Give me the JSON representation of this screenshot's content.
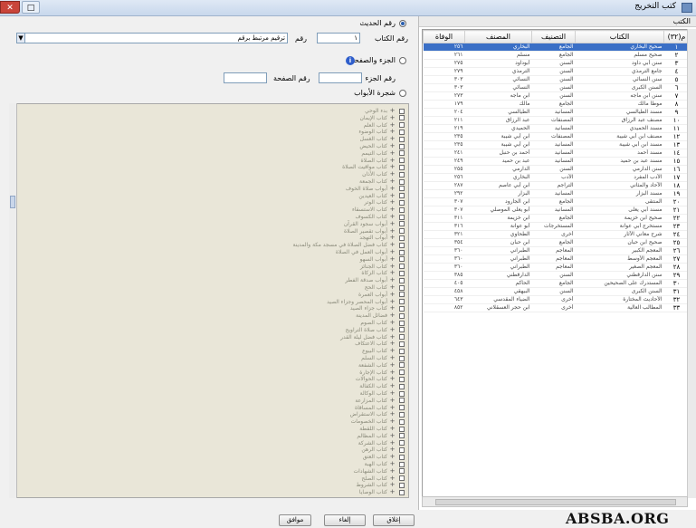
{
  "window": {
    "title": "كتب التخريج",
    "close": "✕",
    "maximize": "□"
  },
  "right_panel": {
    "header": "الكتب",
    "columns": [
      "م(٣٢)",
      "الكتاب",
      "التصنيف",
      "المصنف",
      "الوفاة"
    ],
    "rows": [
      [
        "١",
        "صحيح البخاري",
        "الجامع",
        "البخاري",
        "٢٥٦"
      ],
      [
        "٢",
        "صحيح مسلم",
        "الجامع",
        "مسلم",
        "٢٦١"
      ],
      [
        "٣",
        "سنن أبي داود",
        "السنن",
        "أبوداود",
        "٢٧٥"
      ],
      [
        "٤",
        "جامع الترمذي",
        "السنن",
        "الترمذي",
        "٢٧٩"
      ],
      [
        "٥",
        "سنن النسائي",
        "السنن",
        "النسائي",
        "٣٠٣"
      ],
      [
        "٦",
        "السنن الكبرى",
        "السنن",
        "النسائي",
        "٣٠٣"
      ],
      [
        "٧",
        "سنن ابن ماجه",
        "السنن",
        "ابن ماجه",
        "٢٧٣"
      ],
      [
        "٨",
        "موطأ مالك",
        "الجامع",
        "مالك",
        "١٧٩"
      ],
      [
        "٩",
        "مسند الطيالسي",
        "المسانيد",
        "الطيالسي",
        "٢٠٤"
      ],
      [
        "١٠",
        "مصنف عبد الرزاق",
        "المصنفات",
        "عبد الرزاق",
        "٢١١"
      ],
      [
        "١١",
        "مسند الحميدي",
        "المسانيد",
        "الحميدي",
        "٢١٩"
      ],
      [
        "١٢",
        "مصنف ابن أبي شيبة",
        "المصنفات",
        "ابن أبي شيبة",
        "٢٣٥"
      ],
      [
        "١٣",
        "مسند ابن أبي شيبة",
        "المسانيد",
        "ابن أبي شيبة",
        "٢٣٥"
      ],
      [
        "١٤",
        "مسند أحمد",
        "المسانيد",
        "أحمد بن حنبل",
        "٢٤١"
      ],
      [
        "١٥",
        "مسند عبد بن حميد",
        "المسانيد",
        "عبد بن حميد",
        "٢٤٩"
      ],
      [
        "١٦",
        "سنن الدارمي",
        "السنن",
        "الدارمي",
        "٢٥٥"
      ],
      [
        "١٧",
        "الأدب المفرد",
        "الأدب",
        "البخاري",
        "٢٥٦"
      ],
      [
        "١٨",
        "الآحاد والمثاني",
        "التراجم",
        "ابن أبي عاصم",
        "٢٨٧"
      ],
      [
        "١٩",
        "مسند البزار",
        "المسانيد",
        "البزار",
        "٢٩٢"
      ],
      [
        "٢٠",
        "المنتقى",
        "الجامع",
        "ابن الجارود",
        "٣٠٧"
      ],
      [
        "٢١",
        "مسند أبي يعلى",
        "المسانيد",
        "أبو يعلى الموصلي",
        "٣٠٧"
      ],
      [
        "٢٢",
        "صحيح ابن خزيمة",
        "الجامع",
        "ابن خزيمة",
        "٣١١"
      ],
      [
        "٢٣",
        "مستخرج أبي عوانة",
        "المستخرجات",
        "أبو عوانة",
        "٣١٦"
      ],
      [
        "٢٤",
        "شرح معاني الآثار",
        "أخرى",
        "الطحاوي",
        "٣٢١"
      ],
      [
        "٢٥",
        "صحيح ابن حبان",
        "الجامع",
        "ابن حبان",
        "٣٥٤"
      ],
      [
        "٢٦",
        "المعجم الكبير",
        "المعاجم",
        "الطبراني",
        "٣٦٠"
      ],
      [
        "٢٧",
        "المعجم الأوسط",
        "المعاجم",
        "الطبراني",
        "٣٦٠"
      ],
      [
        "٢٨",
        "المعجم الصغير",
        "المعاجم",
        "الطبراني",
        "٣٦٠"
      ],
      [
        "٢٩",
        "سنن الدارقطني",
        "السنن",
        "الدارقطني",
        "٣٨٥"
      ],
      [
        "٣٠",
        "المستدرك على الصحيحين",
        "الجامع",
        "الحاكم",
        "٤٠٥"
      ],
      [
        "٣١",
        "السنن الكبرى",
        "السنن",
        "البيهقي",
        "٤٥٨"
      ],
      [
        "٣٢",
        "الأحاديث المختارة",
        "أخرى",
        "الضياء المقدسي",
        "٦٤٣"
      ],
      [
        "٣٣",
        "المطالب العالية",
        "أخرى",
        "ابن حجر العسقلاني",
        "٨٥٢"
      ]
    ]
  },
  "left_panel": {
    "option_hadith_number": "رقم الحديث",
    "label_book": "رقم الكتاب",
    "book_field_value": "ترقيم مرتبط برقم",
    "label_number": "رقم",
    "number_field_value": "١",
    "option_part_page": "الجزء والصفحة",
    "label_part": "رقم الجزء",
    "label_page": "رقم الصفحة",
    "option_tree": "شجرة الأبواب",
    "info_icon": "i"
  },
  "tree_items": [
    "بدء الوحي",
    "كتاب الإيمان",
    "كتاب العلم",
    "كتاب الوضوء",
    "كتاب الغسل",
    "كتاب الحيض",
    "كتاب التيمم",
    "كتاب الصلاة",
    "كتاب مواقيت الصلاة",
    "كتاب الأذان",
    "كتاب الجمعة",
    "أبواب صلاة الخوف",
    "كتاب العيدين",
    "كتاب الوتر",
    "كتاب الاستسقاء",
    "كتاب الكسوف",
    "أبواب سجود القرآن",
    "أبواب تقصير الصلاة",
    "أبواب التهجد",
    "كتاب فضل الصلاة في مسجد مكة والمدينة",
    "أبواب العمل في الصلاة",
    "أبواب السهو",
    "كتاب الجنائز",
    "كتاب الزكاة",
    "أبواب صدقة الفطر",
    "كتاب الحج",
    "أبواب العمرة",
    "أبواب المحصر وجزاء الصيد",
    "كتاب جزاء الصيد",
    "فضائل المدينة",
    "كتاب الصوم",
    "كتاب صلاة التراويح",
    "كتاب فضل ليلة القدر",
    "كتاب الاعتكاف",
    "كتاب البيوع",
    "كتاب السلم",
    "كتاب الشفعة",
    "كتاب الإجارة",
    "كتاب الحوالات",
    "كتاب الكفالة",
    "كتاب الوكالة",
    "كتاب المزارعة",
    "كتاب المساقاة",
    "كتاب الاستقراض",
    "كتاب الخصومات",
    "كتاب اللقطة",
    "كتاب المظالم",
    "كتاب الشركة",
    "كتاب الرهن",
    "كتاب العتق",
    "كتاب الهبة",
    "كتاب الشهادات",
    "كتاب الصلح",
    "كتاب الشروط",
    "كتاب الوصايا"
  ],
  "buttons": {
    "ok": "موافق",
    "cancel": "إلغاء",
    "close": "إغلاق"
  },
  "watermark": "ABSBA.ORG"
}
